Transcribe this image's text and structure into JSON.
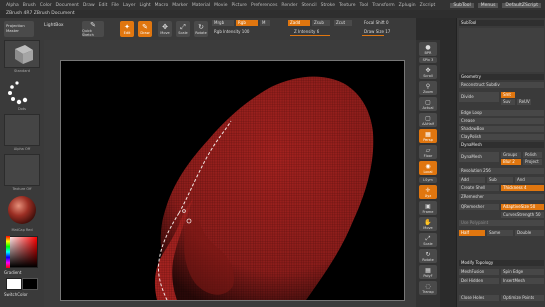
{
  "menu": {
    "items": [
      "Alpha",
      "Brush",
      "Color",
      "Document",
      "Draw",
      "Edit",
      "File",
      "Layer",
      "Light",
      "Macro",
      "Marker",
      "Material",
      "Movie",
      "Picture",
      "Preferences",
      "Render",
      "Stencil",
      "Stroke",
      "Texture",
      "Tool",
      "Transform",
      "Zplugin",
      "Zscript"
    ],
    "right": [
      "SubTool",
      "Menus",
      "DefaultZScript"
    ]
  },
  "info_bar": "ZBrush 4R7 ZBrush Document",
  "toolbar": {
    "projection_master": "Projection Master",
    "lightbox": "LightBox",
    "quick_sketch": "Quick Sketch",
    "edit": "Edit",
    "draw": "Draw",
    "move": "Move",
    "scale": "Scale",
    "rotate": "Rotate",
    "mrgb": "Mrgb",
    "rgb": "Rgb",
    "m": "M",
    "zadd": "Zadd",
    "zsub": "Zsub",
    "zcut": "Zcut",
    "rgb_intensity": "Rgb Intensity 100",
    "z_intensity": "Z Intensity 6",
    "focal_shift": "Focal Shift 0",
    "draw_size": "Draw Size 17"
  },
  "left_tray": {
    "brush_caption": "Standard",
    "stroke_caption": "Dots",
    "alpha_caption": "Alpha Off",
    "texture_caption": "Texture Off",
    "material_caption": "MatCap Red",
    "gradient": "Gradient",
    "switch_color": "SwitchColor"
  },
  "right_shelf": [
    "BPR",
    "SPix 3",
    "Scroll",
    "Zoom",
    "Actual",
    "AAHalf",
    "Persp",
    "Floor",
    "Local",
    "LSym",
    "Xyz",
    "Frame",
    "Move",
    "Scale",
    "Rotate",
    "PolyF",
    "Transp"
  ],
  "palette": {
    "title": "SubTool",
    "rows": [
      {
        "label": "Geometry",
        "style": "head"
      },
      {
        "label": "Reconstruct Subdiv",
        "style": "normal"
      },
      {
        "label": "Divide",
        "style": "normal"
      },
      {
        "label": "Edge Loop",
        "style": "normal"
      },
      {
        "label": "Crease",
        "style": "normal"
      },
      {
        "label": "ShadowBox",
        "style": "normal"
      },
      {
        "label": "ClayPolish",
        "style": "normal"
      },
      {
        "label": "DynaMesh",
        "style": "head"
      },
      {
        "label": "DynaMesh",
        "style": "normal"
      },
      {
        "label": "Resolution 256",
        "style": "normal"
      },
      {
        "label": "Add",
        "style": "normal"
      },
      {
        "label": "Create Shell",
        "style": "normal"
      },
      {
        "label": "ZRemesher",
        "style": "normal"
      },
      {
        "label": "QRemesher",
        "style": "normal"
      },
      {
        "label": "Modify Topology",
        "style": "head"
      },
      {
        "label": "MeshFusion",
        "style": "normal"
      },
      {
        "label": "Del Hidden",
        "style": "normal"
      },
      {
        "label": "Close Holes",
        "style": "normal"
      }
    ],
    "divide_options": [
      "Smt",
      "Suv",
      "ReUV"
    ],
    "dynamesh_options": [
      "Groups",
      "Polish",
      "Blur 2",
      "Project"
    ],
    "sub_and": [
      "Sub",
      "And"
    ],
    "thickness": "Thickness 4",
    "half_same_double": [
      "Half",
      "Same",
      "Double"
    ],
    "spin_edge": "Spin Edge",
    "insert_mesh": "InsertMesh",
    "optimize_points": "Optimize Points",
    "adaptive_size": "AdaptiveSize 50",
    "curves_strength": "CurvesStrength 50",
    "use_polypaint": "Use Polypaint"
  },
  "colors": {
    "accent": "#e0760f",
    "panel": "#3a3a3a",
    "canvas": "#000000",
    "mesh": "#a3221f"
  }
}
